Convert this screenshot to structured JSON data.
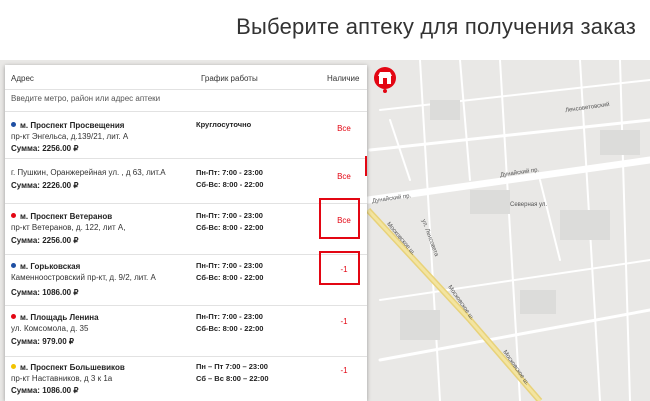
{
  "page": {
    "title": "Выберите аптеку для получения заказ"
  },
  "panel": {
    "headers": {
      "address": "Адрес",
      "schedule": "График работы",
      "availability": "Наличие"
    },
    "search_placeholder": "Введите метро, район или адрес аптеки",
    "items": [
      {
        "metro": "м. Проспект Просвещения",
        "metro_color": "#1e4fa3",
        "address": "пр-кт Энгельса, д.139/21, лит. А",
        "sum": "Сумма: 2256.00 ₽",
        "schedule": [
          "Круглосуточно"
        ],
        "availability": "Все"
      },
      {
        "metro": "",
        "metro_color": "",
        "address": "г. Пушкин, Оранжерейная ул. , д 63, лит.А",
        "sum": "Сумма: 2226.00 ₽",
        "schedule": [
          "Пн-Пт: 7:00 - 23:00",
          "Сб-Вс: 8:00 - 22:00"
        ],
        "availability": "Все"
      },
      {
        "metro": "м. Проспект Ветеранов",
        "metro_color": "#e30613",
        "address": "пр-кт Ветеранов, д. 122, лит А,",
        "sum": "Сумма: 2256.00 ₽",
        "schedule": [
          "Пн-Пт: 7:00 - 23:00",
          "Сб-Вс: 8:00 - 22:00"
        ],
        "availability": "Все"
      },
      {
        "metro": "м. Горьковская",
        "metro_color": "#1e4fa3",
        "address": "Каменноостровский пр-кт, д. 9/2, лит. А",
        "sum": "Сумма: 1086.00 ₽",
        "schedule": [
          "Пн-Пт: 7:00 - 23:00",
          "Сб-Вс: 8:00 - 22:00"
        ],
        "availability": "-1"
      },
      {
        "metro": "м. Площадь Ленина",
        "metro_color": "#e30613",
        "address": "ул. Комсомола, д. 35",
        "sum": "Сумма: 979.00 ₽",
        "schedule": [
          "Пн-Пт: 7:00 - 23:00",
          "Сб-Вс: 8:00 - 22:00"
        ],
        "availability": "-1"
      },
      {
        "metro": "м. Проспект Большевиков",
        "metro_color": "#f2c300",
        "address": "пр-кт Наставников, д 3 к 1а",
        "sum": "Сумма: 1086.00 ₽",
        "schedule": [
          "Пн – Пт 7:00 – 23:00",
          "Сб – Вс 8:00 – 22:00"
        ],
        "availability": "-1"
      }
    ]
  },
  "map": {
    "labels": [
      "Дунайский пр.",
      "Дунайский пр.",
      "Московское ш.",
      "Московское ш.",
      "Московское ш.",
      "ул. Ленсовета",
      "Северная ул.",
      "Ленсоветовский"
    ],
    "pin_icon": "pharmacy-pin-icon",
    "accent": "#e30613"
  }
}
